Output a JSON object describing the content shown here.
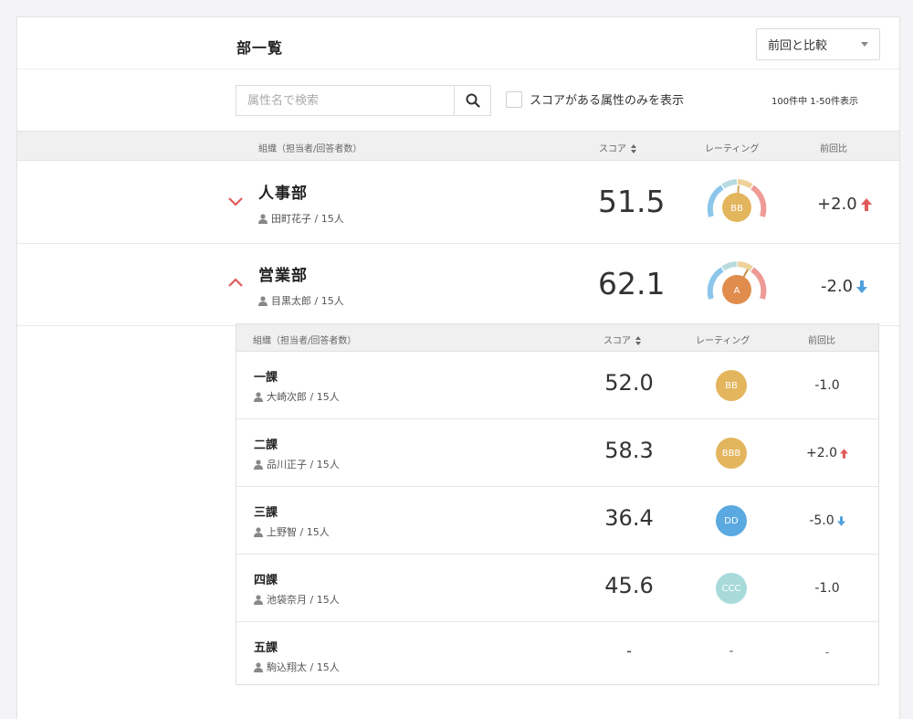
{
  "header": {
    "title": "部一覧",
    "compare_label": "前回と比較"
  },
  "toolbar": {
    "search_placeholder": "属性名で検索",
    "filter_label": "スコアがある属性のみを表示",
    "count_text": "100件中 1-50件表示"
  },
  "columns": {
    "org": "組織（担当者/回答者数）",
    "score": "スコア",
    "rating": "レーティング",
    "diff": "前回比"
  },
  "departments": [
    {
      "name": "人事部",
      "person": "田町花子 / 15人",
      "score": "51.5",
      "rating": "BB",
      "rating_color": "#e3b55d",
      "diff": "+2.0",
      "trend": "up",
      "expanded": false
    },
    {
      "name": "営業部",
      "person": "目黒太郎 / 15人",
      "score": "62.1",
      "rating": "A",
      "rating_color": "#e08c4c",
      "diff": "-2.0",
      "trend": "down",
      "expanded": true
    }
  ],
  "sections": [
    {
      "name": "一課",
      "person": "大崎次郎 / 15人",
      "score": "52.0",
      "rating": "BB",
      "rating_color": "#e3b55d",
      "diff": "-1.0",
      "trend": "none"
    },
    {
      "name": "二課",
      "person": "品川正子 / 15人",
      "score": "58.3",
      "rating": "BBB",
      "rating_color": "#e3b55d",
      "diff": "+2.0",
      "trend": "up"
    },
    {
      "name": "三課",
      "person": "上野智 / 15人",
      "score": "36.4",
      "rating": "DD",
      "rating_color": "#5aa9e0",
      "diff": "-5.0",
      "trend": "down"
    },
    {
      "name": "四課",
      "person": "池袋奈月 / 15人",
      "score": "45.6",
      "rating": "CCC",
      "rating_color": "#a8dada",
      "diff": "-1.0",
      "trend": "none"
    },
    {
      "name": "五課",
      "person": "駒込翔太 / 15人",
      "score": "-",
      "rating": "-",
      "rating_color": "",
      "diff": "-",
      "trend": "none"
    }
  ],
  "colors": {
    "up": "#e05a5a",
    "down": "#4ea1dc",
    "chevron": "#e05a5a"
  },
  "icons": {
    "search": "search-icon",
    "person": "person-icon",
    "expand": "chevron-down-icon",
    "collapse": "chevron-up-icon",
    "sort": "sort-icon",
    "up": "arrow-up-icon",
    "down": "arrow-down-icon"
  }
}
